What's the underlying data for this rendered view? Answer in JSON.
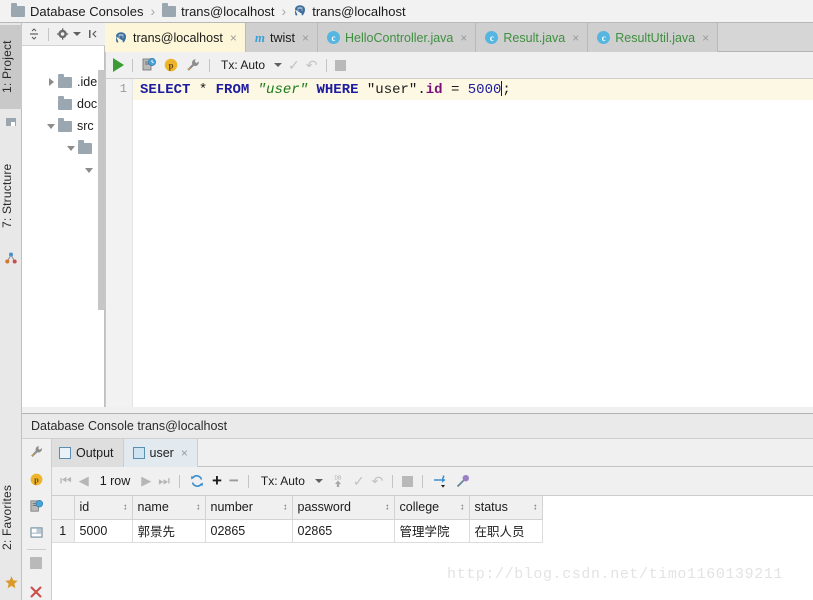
{
  "breadcrumb": {
    "items": [
      {
        "label": "Database Consoles",
        "icon": "folder-icon"
      },
      {
        "label": "trans@localhost",
        "icon": "folder-icon"
      },
      {
        "label": "trans@localhost",
        "icon": "postgresql-icon"
      }
    ],
    "separator": "›"
  },
  "left_strip": {
    "project_tab": "1: Project",
    "structure_tab": "7: Structure",
    "favorites_tab": "2: Favorites"
  },
  "project_panel": {
    "toolbar": {
      "collapse_all": "collapse-all-icon",
      "settings": "gear-icon",
      "hide": "hide-panel-icon"
    },
    "tree": [
      {
        "label": ".ide",
        "expander": "right",
        "icon": "folder-icon"
      },
      {
        "label": "doc",
        "expander": "none",
        "icon": "folder-icon"
      },
      {
        "label": "src",
        "expander": "down",
        "icon": "folder-icon"
      },
      {
        "label": "",
        "expander": "down",
        "icon": "folder-icon"
      },
      {
        "label": "",
        "expander": "down",
        "icon": "none"
      }
    ]
  },
  "editor_tabs": [
    {
      "label": "trans@localhost",
      "icon": "postgresql-icon",
      "active": true,
      "color": "dark",
      "close": "×"
    },
    {
      "label": "twist",
      "icon": "maven-icon",
      "active": false,
      "color": "dark",
      "close": "×"
    },
    {
      "label": "HelloController.java",
      "icon": "java-class-icon",
      "active": false,
      "color": "green",
      "close": "×"
    },
    {
      "label": "Result.java",
      "icon": "java-class-icon",
      "active": false,
      "color": "green",
      "close": "×"
    },
    {
      "label": "ResultUtil.java",
      "icon": "java-class-icon",
      "active": false,
      "color": "green",
      "close": "×"
    }
  ],
  "sql_toolbar": {
    "run": "run-icon",
    "history": "query-history-icon",
    "params": "parameters-icon",
    "wrench": "wrench-icon",
    "tx_label": "Tx: Auto",
    "commit": "commit-icon",
    "rollback": "rollback-icon",
    "stop": "stop-icon"
  },
  "editor": {
    "line_number": "1",
    "sql_tokens": [
      {
        "text": "SELECT",
        "type": "keyword"
      },
      {
        "text": " * ",
        "type": "plain"
      },
      {
        "text": "FROM",
        "type": "keyword"
      },
      {
        "text": " ",
        "type": "plain"
      },
      {
        "text": "\"user\"",
        "type": "string"
      },
      {
        "text": " ",
        "type": "plain"
      },
      {
        "text": "WHERE",
        "type": "keyword"
      },
      {
        "text": " ",
        "type": "plain"
      },
      {
        "text": "\"user\"",
        "type": "plain"
      },
      {
        "text": ".",
        "type": "plain"
      },
      {
        "text": "id",
        "type": "identifier"
      },
      {
        "text": " = ",
        "type": "plain"
      },
      {
        "text": "5000",
        "type": "number"
      },
      {
        "text": ";",
        "type": "plain"
      }
    ],
    "sql_text": "SELECT * FROM \"user\" WHERE \"user\".id = 5000;"
  },
  "console": {
    "title": "Database Console trans@localhost",
    "tabs": [
      {
        "label": "Output",
        "icon": "output-icon",
        "selected": false,
        "close": ""
      },
      {
        "label": "user",
        "icon": "table-icon",
        "selected": true,
        "close": "×"
      }
    ],
    "toolbar": {
      "first": "⏮",
      "prev": "◀",
      "row_count": "1 row",
      "next": "▶",
      "last": "⏭",
      "reload": "reload-icon",
      "add_row": "+",
      "delete_row": "−",
      "tx_label": "Tx: Auto",
      "submit_db": "submit-to-database-icon",
      "commit": "commit-icon",
      "rollback": "rollback-icon",
      "stop": "stop-icon",
      "transpose": "transpose-icon",
      "pin": "pin-tab-icon"
    }
  },
  "result_grid": {
    "row_header": "",
    "columns": [
      "id",
      "name",
      "number",
      "password",
      "college",
      "status"
    ],
    "sort_marker": "↕",
    "rows": [
      {
        "num": "1",
        "cells": [
          "5000",
          "郭景先",
          "02865",
          "02865",
          "管理学院",
          "在职人员"
        ]
      }
    ]
  },
  "watermark": "http://blog.csdn.net/timo1160139211",
  "colors": {
    "accent_blue": "#3a8fd0",
    "run_green": "#3a9c32",
    "tab_active_bg": "#fdf6d8",
    "keyword_blue": "#1d1ca0",
    "string_green": "#1b7a1b",
    "identifier_purple": "#7a0f7a"
  }
}
